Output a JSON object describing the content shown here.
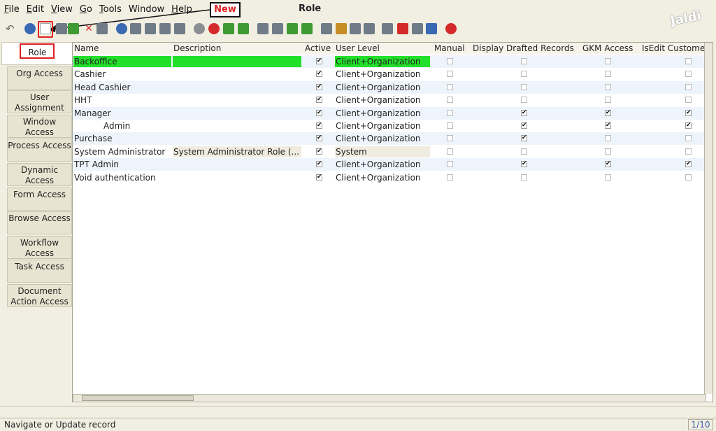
{
  "menu": [
    {
      "label": "File",
      "u": "F",
      "rest": "ile"
    },
    {
      "label": "Edit",
      "u": "E",
      "rest": "dit"
    },
    {
      "label": "View",
      "u": "V",
      "rest": "iew"
    },
    {
      "label": "Go",
      "u": "G",
      "rest": "o"
    },
    {
      "label": "Tools",
      "u": "T",
      "rest": "ools"
    },
    {
      "label": "Window",
      "u": "",
      "rest": "Window"
    },
    {
      "label": "Help",
      "u": "H",
      "rest": "elp"
    }
  ],
  "window_title": "Role",
  "logo_text": "Jaldi",
  "callout_label": "New",
  "tabs": [
    {
      "label": "Role",
      "active": true
    },
    {
      "label": "Org Access"
    },
    {
      "label": "User Assignment"
    },
    {
      "label": "Window Access"
    },
    {
      "label": "Process Access"
    },
    {
      "label": "Dynamic Access"
    },
    {
      "label": "Form Access"
    },
    {
      "label": "Browse Access"
    },
    {
      "label": "Workflow Access"
    },
    {
      "label": "Task Access"
    },
    {
      "label": "Document Action Access"
    }
  ],
  "columns": [
    "Name",
    "Description",
    "Active",
    "User Level",
    "Manual",
    "Display Drafted Records",
    "GKM Access",
    "IsEdit Custome"
  ],
  "rows": [
    {
      "name": "Backoffice",
      "desc": "",
      "active": true,
      "level": "Client+Organization",
      "manual": false,
      "drafted": false,
      "gkm": false,
      "isedit": false,
      "selected": true
    },
    {
      "name": "Cashier",
      "desc": "",
      "active": true,
      "level": "Client+Organization",
      "manual": false,
      "drafted": false,
      "gkm": false,
      "isedit": false
    },
    {
      "name": "Head Cashier",
      "desc": "",
      "active": true,
      "level": "Client+Organization",
      "manual": false,
      "drafted": false,
      "gkm": false,
      "isedit": false
    },
    {
      "name": "HHT",
      "desc": "",
      "active": true,
      "level": "Client+Organization",
      "manual": false,
      "drafted": false,
      "gkm": false,
      "isedit": false
    },
    {
      "name": "Manager",
      "desc": "",
      "active": true,
      "level": "Client+Organization",
      "manual": false,
      "drafted": true,
      "gkm": true,
      "isedit": true
    },
    {
      "name": "Admin",
      "desc": "",
      "active": true,
      "level": "Client+Organization",
      "manual": false,
      "drafted": true,
      "gkm": true,
      "isedit": true,
      "indent": true
    },
    {
      "name": "Purchase",
      "desc": "",
      "active": true,
      "level": "Client+Organization",
      "manual": false,
      "drafted": true,
      "gkm": false,
      "isedit": false
    },
    {
      "name": "System Administrator",
      "desc": "System Administrator Role (...",
      "active": true,
      "level": "System",
      "manual": false,
      "drafted": false,
      "gkm": false,
      "isedit": false,
      "system": true
    },
    {
      "name": "TPT Admin",
      "desc": "",
      "active": true,
      "level": "Client+Organization",
      "manual": false,
      "drafted": true,
      "gkm": true,
      "isedit": true
    },
    {
      "name": "Void authentication",
      "desc": "",
      "active": true,
      "level": "Client+Organization",
      "manual": false,
      "drafted": false,
      "gkm": false,
      "isedit": false
    }
  ],
  "status": {
    "message": "Navigate or Update record",
    "record_count": "1/10"
  }
}
